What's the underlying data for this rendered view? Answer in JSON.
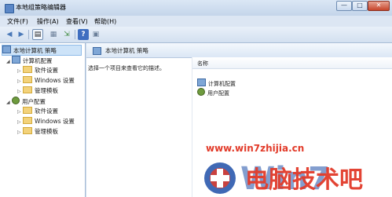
{
  "window": {
    "title": "本地组策略编辑器",
    "min_label": "—",
    "max_label": "□",
    "close_label": "✕"
  },
  "menu": [
    "文件(F)",
    "操作(A)",
    "查看(V)",
    "帮助(H)"
  ],
  "toolbar": {
    "icons": [
      "back-arrow-icon",
      "forward-arrow-icon",
      "show-tree-icon",
      "properties-icon",
      "export-icon",
      "help-icon",
      "view-icon"
    ]
  },
  "tree": {
    "root": "本地计算机 策略",
    "computer_config": "计算机配置",
    "user_config": "用户配置",
    "children": [
      "软件设置",
      "Windows 设置",
      "管理模板"
    ]
  },
  "main": {
    "title": "本地计算机 策略",
    "description": "选择一个项目来查看它的描述。",
    "column_header": "名称",
    "rows": [
      "计算机配置",
      "用户配置"
    ]
  },
  "watermark": {
    "url": "www.win7zhijia.cn",
    "brand": "电脑技术吧",
    "colors": {
      "red": "#e23b2a",
      "blue": "#1e4fa8"
    }
  }
}
